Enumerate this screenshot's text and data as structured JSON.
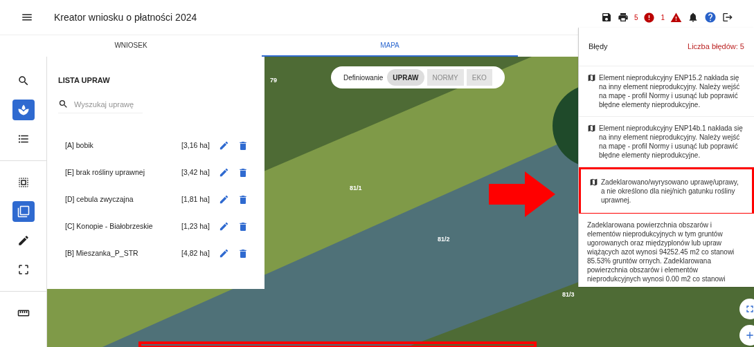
{
  "header": {
    "title": "Kreator wniosku o płatności 2024",
    "error_count": "5",
    "warning_count": "1"
  },
  "tabs": [
    {
      "label": "WNIOSEK",
      "selected": false
    },
    {
      "label": "MAPA",
      "selected": true
    }
  ],
  "rail": [
    {
      "kind": "search",
      "selected": false
    },
    {
      "kind": "crop",
      "selected": true
    },
    {
      "kind": "list",
      "selected": false
    },
    {
      "kind": "select",
      "selected": false
    },
    {
      "kind": "copy",
      "selected": true
    },
    {
      "kind": "edit",
      "selected": false
    },
    {
      "kind": "frame",
      "selected": false
    },
    {
      "kind": "measure",
      "selected": false
    }
  ],
  "list_panel": {
    "title": "LISTA UPRAW",
    "search": {
      "placeholder": "Wyszukaj uprawę"
    },
    "crops": [
      {
        "name": "[A] bobik",
        "area": "[3,16 ha]"
      },
      {
        "name": "[E] brak rośliny uprawnej",
        "area": "[3,42 ha]"
      },
      {
        "name": "[D] cebula zwyczajna",
        "area": "[1,81 ha]"
      },
      {
        "name": "[C] Konopie - Białobrzeskie",
        "area": "[1,23 ha]"
      },
      {
        "name": "[B] Mieszanka_P_STR",
        "area": "[4,82 ha]"
      }
    ]
  },
  "mode_toggle": {
    "label": "Definiowanie",
    "options": [
      {
        "label": "UPRAW",
        "selected": true,
        "disabled": false
      },
      {
        "label": "NORMY",
        "selected": false,
        "disabled": true
      },
      {
        "label": "EKO",
        "selected": false,
        "disabled": true
      }
    ]
  },
  "map": {
    "parcels": [
      {
        "label": "79"
      },
      {
        "label": "81/1"
      },
      {
        "label": "81/2"
      },
      {
        "label": "81/3"
      }
    ]
  },
  "errors": {
    "title": "Błędy",
    "count": "Liczba błędów: 5",
    "items": [
      {
        "kind": "map",
        "highlighted": false,
        "text": "Element nieprodukcyjny ENP15.2 nakłada się na inny element nieprodukcyjny. Należy wejść na mapę - profil Normy i usunąć lub poprawić błędne elementy nieprodukcyjne."
      },
      {
        "kind": "map",
        "highlighted": false,
        "text": "Element nieprodukcyjny ENP14b.1 nakłada się na inny element nieprodukcyjny. Należy wejść na mapę - profil Normy i usunąć lub poprawić błędne elementy nieprodukcyjne."
      },
      {
        "kind": "map",
        "highlighted": true,
        "text": "Zadeklarowano/wyrysowano uprawę/uprawy, a nie określono dla niej/nich gatunku rośliny uprawnej."
      },
      {
        "kind": "plain",
        "highlighted": false,
        "text": "Zadeklarowana powierzchnia obszarów i elementów nieprodukcyjnych w tym gruntów ugorowanych oraz międzyplonów lub upraw wiążących azot wynosi 94252.45 m2 co stanowi 85.53% gruntów ornych. Zadeklarowana powierzchnia obszarów i elementów nieprodukcyjnych wynosi 0.00 m2 co stanowi"
      }
    ]
  }
}
